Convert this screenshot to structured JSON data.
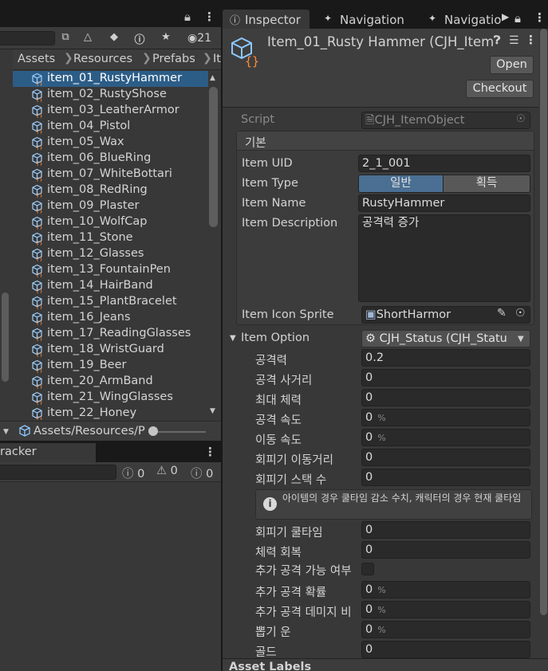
{
  "project": {
    "breadcrumb": [
      "Assets",
      "Resources",
      "Prefabs",
      "It"
    ],
    "visible_count": "21",
    "files": [
      "item_01_RustyHammer",
      "item_02_RustyShose",
      "item_03_LeatherArmor",
      "item_04_Pistol",
      "item_05_Wax",
      "item_06_BlueRing",
      "item_07_WhiteBottari",
      "item_08_RedRing",
      "item_09_Plaster",
      "item_10_WolfCap",
      "item_11_Stone",
      "item_12_Glasses",
      "item_13_FountainPen",
      "item_14_HairBand",
      "item_15_PlantBracelet",
      "item_16_Jeans",
      "item_17_ReadingGlasses",
      "item_18_WristGuard",
      "item_19_Beer",
      "item_20_ArmBand",
      "item_21_WingGlasses",
      "item_22_Honey"
    ],
    "selected_index": 0,
    "footer_path": "Assets/Resources/P"
  },
  "tracker": {
    "title": "racker",
    "counts": {
      "info": "0",
      "warning": "0",
      "error": "0"
    }
  },
  "inspector": {
    "tabs": [
      "Inspector",
      "Navigation",
      "Navigatio"
    ],
    "object_title": "Item_01_Rusty Hammer (CJH_Item",
    "open_label": "Open",
    "checkout_label": "Checkout",
    "script_label": "Script",
    "script_value": "CJH_ItemObject",
    "group_title": "기본",
    "item_uid_label": "Item UID",
    "item_uid": "2_1_001",
    "item_type_label": "Item Type",
    "item_type_options": [
      "일반",
      "획득"
    ],
    "item_type_selected": 0,
    "item_name_label": "Item Name",
    "item_name": "RustyHammer",
    "item_desc_label": "Item Description",
    "item_desc": "공격력 증가",
    "item_icon_label": "Item Icon Sprite",
    "item_icon_value": "ShortHarmor",
    "item_option_label": "Item Option",
    "item_option_value": "CJH_Status (CJH_Statu",
    "stats": [
      {
        "label": "공격력",
        "value": "0.2",
        "pct": ""
      },
      {
        "label": "공격 사거리",
        "value": "0",
        "pct": ""
      },
      {
        "label": "최대 체력",
        "value": "0",
        "pct": ""
      },
      {
        "label": "공격 속도",
        "value": "0",
        "pct": "%"
      },
      {
        "label": "이동 속도",
        "value": "0",
        "pct": "%"
      },
      {
        "label": "회피기 이동거리",
        "value": "0",
        "pct": ""
      },
      {
        "label": "회피기 스택 수",
        "value": "0",
        "pct": ""
      }
    ],
    "help_text": "아이템의 경우 쿨타임 감소 수치, 캐릭터의 경우 현재 쿨타임",
    "stats2": [
      {
        "label": "회피기 쿨타임",
        "value": "0",
        "pct": ""
      },
      {
        "label": "체력 회복",
        "value": "0",
        "pct": ""
      }
    ],
    "extra_attack_check_label": "추가 공격 가능 여부",
    "stats3": [
      {
        "label": "추가 공격 확률",
        "value": "0",
        "pct": "%"
      },
      {
        "label": "추가 공격 데미지 비",
        "value": "0",
        "pct": "%"
      },
      {
        "label": "뽑기 운",
        "value": "0",
        "pct": "%"
      },
      {
        "label": "골드",
        "value": "0",
        "pct": ""
      }
    ],
    "asset_labels": "Asset Labels"
  }
}
